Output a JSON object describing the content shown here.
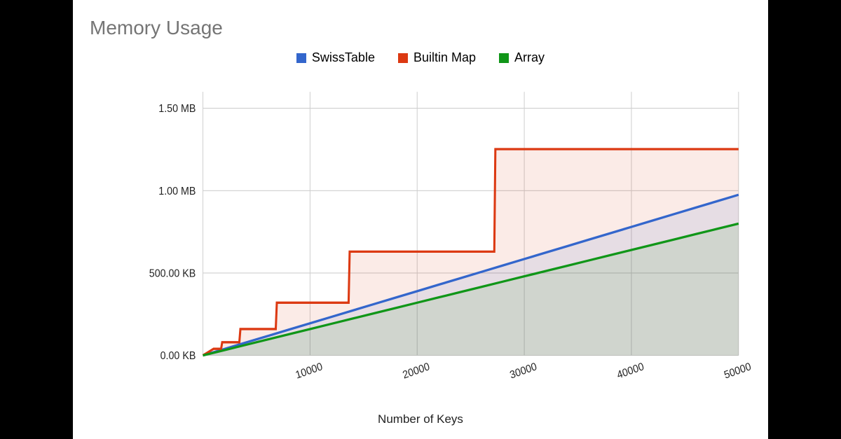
{
  "chart_data": {
    "type": "area",
    "title": "Memory Usage",
    "xlabel": "Number of Keys",
    "ylabel": "",
    "xlim": [
      0,
      50000
    ],
    "ylim": [
      0,
      1600000
    ],
    "x_ticks": [
      10000,
      20000,
      30000,
      40000,
      50000
    ],
    "x_tick_labels": [
      "10000",
      "20000",
      "30000",
      "40000",
      "50000"
    ],
    "y_ticks": [
      0,
      500000,
      1000000,
      1500000
    ],
    "y_tick_labels": [
      "0.00 KB",
      "500.00 KB",
      "1.00 MB",
      "1.50 MB"
    ],
    "series": [
      {
        "name": "SwissTable",
        "color": "#3366cc",
        "x": [
          0,
          2000,
          4000,
          6000,
          8000,
          10000,
          12000,
          14000,
          16000,
          18000,
          20000,
          22000,
          24000,
          26000,
          28000,
          30000,
          32000,
          34000,
          36000,
          38000,
          40000,
          42000,
          44000,
          46000,
          48000,
          50000
        ],
        "values": [
          0,
          39000,
          78000,
          117000,
          156000,
          195000,
          234000,
          273000,
          312000,
          351000,
          390000,
          429000,
          468000,
          507000,
          546000,
          585000,
          624000,
          663000,
          702000,
          741000,
          780000,
          819000,
          858000,
          897000,
          936000,
          975000
        ]
      },
      {
        "name": "Builtin Map",
        "color": "#dc3912",
        "x": [
          0,
          500,
          1000,
          1700,
          1800,
          3400,
          3500,
          6800,
          6900,
          13600,
          13700,
          27200,
          27300,
          50000
        ],
        "values": [
          0,
          20000,
          40000,
          40000,
          80000,
          80000,
          160000,
          160000,
          320000,
          320000,
          630000,
          630000,
          1252000,
          1252000
        ]
      },
      {
        "name": "Array",
        "color": "#109618",
        "x": [
          0,
          2000,
          4000,
          6000,
          8000,
          10000,
          12000,
          14000,
          16000,
          18000,
          20000,
          22000,
          24000,
          26000,
          28000,
          30000,
          32000,
          34000,
          36000,
          38000,
          40000,
          42000,
          44000,
          46000,
          48000,
          50000
        ],
        "values": [
          0,
          32000,
          64000,
          96000,
          128000,
          160000,
          192000,
          224000,
          256000,
          288000,
          320000,
          352000,
          384000,
          416000,
          448000,
          480000,
          512000,
          544000,
          576000,
          608000,
          640000,
          672000,
          704000,
          736000,
          768000,
          800000
        ]
      }
    ],
    "legend_position": "top",
    "grid": true
  }
}
